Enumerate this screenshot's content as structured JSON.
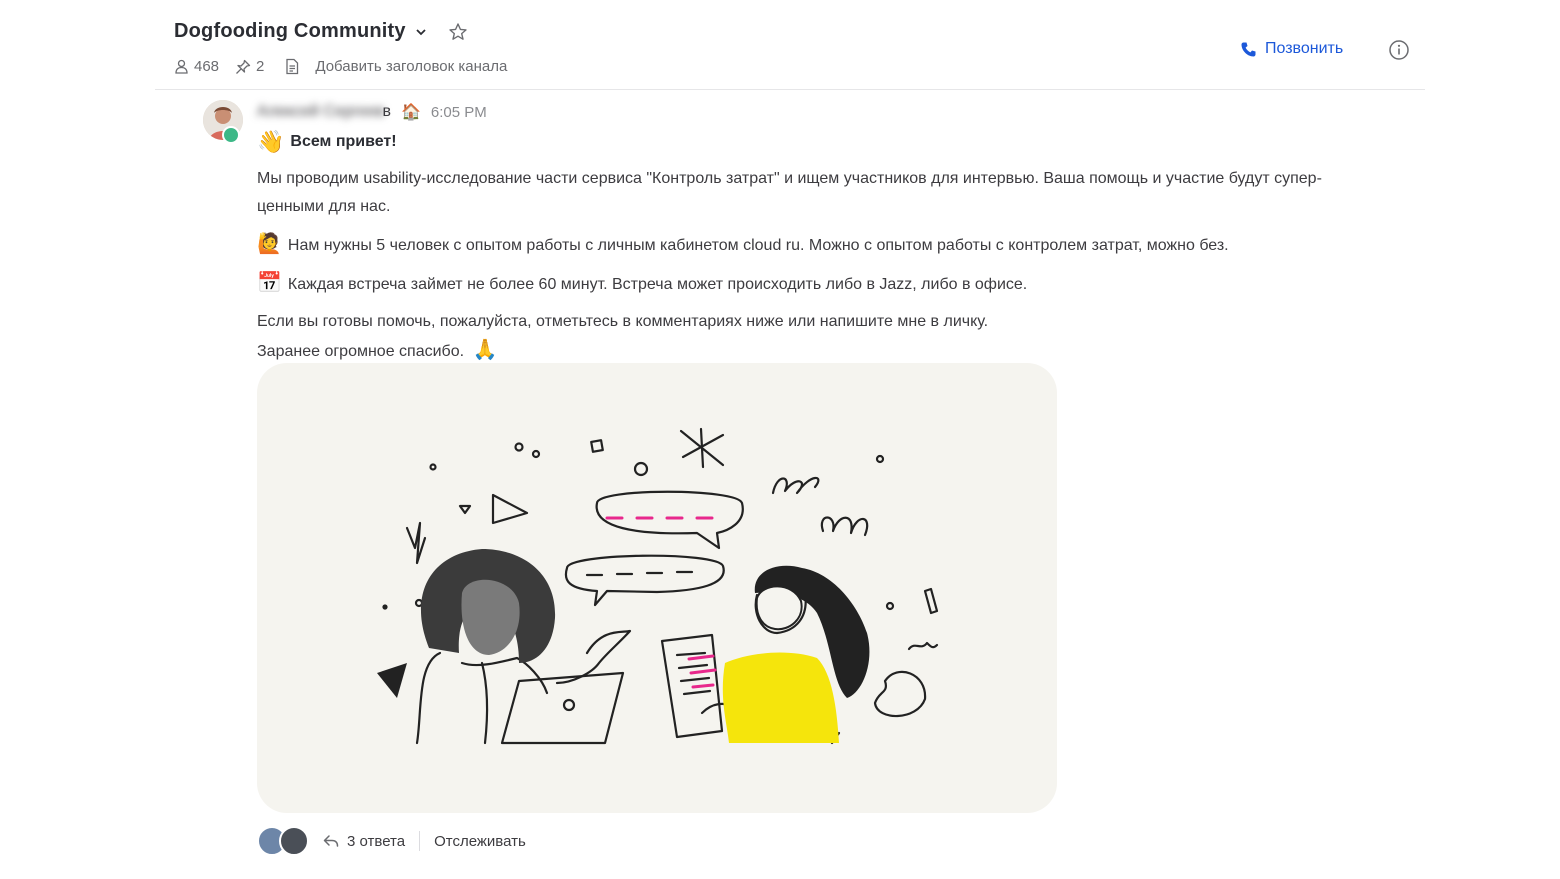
{
  "header": {
    "channel_title": "Dogfooding Community",
    "members_count": "468",
    "pinned_count": "2",
    "add_header_placeholder": "Добавить заголовок канала",
    "call_label": "Позвонить"
  },
  "message": {
    "author_visible_suffix": "в",
    "author_blurred": "Алексей Сергеев",
    "status_emoji": "🏠",
    "time": "6:05 PM",
    "greeting_emoji": "👋",
    "greeting": "Всем привет!",
    "para1": "Мы проводим usability-исследование части сервиса \"Контроль затрат\" и ищем участников для интервью. Ваша помощь и участие будут супер-ценными для нас.",
    "para2_emoji": "🙋",
    "para2": "Нам нужны 5 человек с опытом работы с личным кабинетом cloud ru. Можно с опытом работы с контролем затрат, можно без.",
    "para3_emoji": "📅",
    "para3": "Каждая встреча займет не более 60 минут. Встреча может происходить либо в Jazz, либо в офисе.",
    "para4": "Если вы готовы помочь, пожалуйста, отметьтесь в комментариях ниже или напишите мне в личку.",
    "para5": "Заранее огромное спасибо.",
    "para5_emoji": "🙏"
  },
  "thread": {
    "replies_label": "3 ответа",
    "follow_label": "Отслеживать"
  },
  "icons": {
    "members": "members-icon",
    "pin": "pin-icon",
    "doc": "document-icon",
    "phone": "phone-icon",
    "info": "info-icon",
    "star": "star-icon",
    "chevron": "chevron-down-icon",
    "reply": "reply-icon"
  },
  "colors": {
    "accent": "#1c58d9",
    "online": "#3db887",
    "highlight_yellow": "#f5e50c",
    "dash_magenta": "#e8288c"
  }
}
